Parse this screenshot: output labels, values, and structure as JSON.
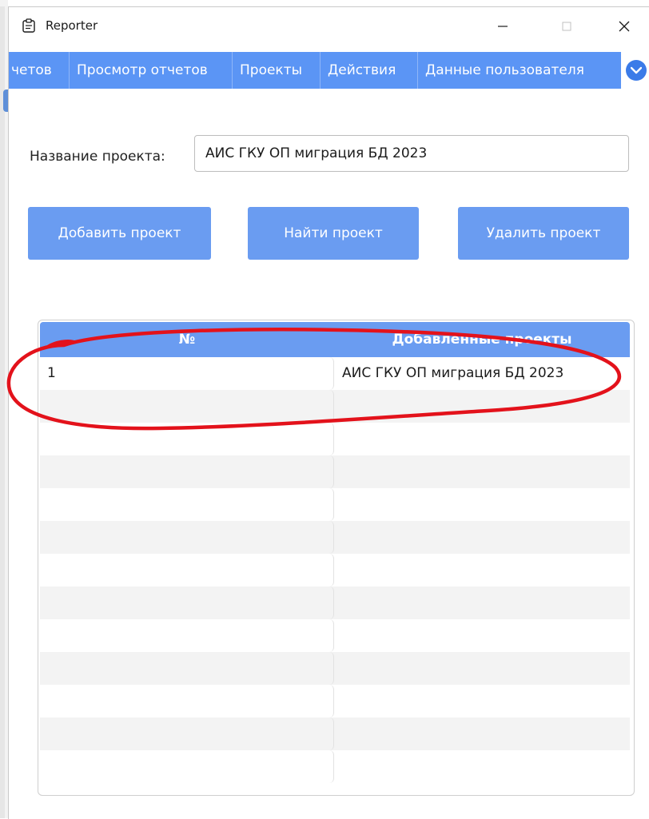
{
  "window": {
    "title": "Reporter",
    "controls": {
      "minimize": "—",
      "maximize": "□",
      "close": "✕"
    }
  },
  "tabs": [
    {
      "label": "четов"
    },
    {
      "label": "Просмотр отчетов"
    },
    {
      "label": "Проекты"
    },
    {
      "label": "Действия"
    },
    {
      "label": "Данные пользователя"
    }
  ],
  "form": {
    "project_name_label": "Название проекта:",
    "project_name_value": "АИС ГКУ ОП миграция БД 2023"
  },
  "buttons": {
    "add": "Добавить проект",
    "find": "Найти проект",
    "delete": "Удалить проект"
  },
  "table": {
    "headers": [
      "№",
      "Добавленные проекты"
    ],
    "rows": [
      [
        "1",
        "АИС ГКУ ОП миграция БД 2023"
      ],
      [
        "",
        ""
      ],
      [
        "",
        ""
      ],
      [
        "",
        ""
      ],
      [
        "",
        ""
      ],
      [
        "",
        ""
      ],
      [
        "",
        ""
      ],
      [
        "",
        ""
      ],
      [
        "",
        ""
      ],
      [
        "",
        ""
      ],
      [
        "",
        ""
      ],
      [
        "",
        ""
      ],
      [
        "",
        ""
      ]
    ]
  },
  "colors": {
    "accent": "#5b95f5",
    "button": "#6a9cf1",
    "annotation": "#e3121b"
  },
  "icons": {
    "app": "clipboard-icon",
    "tab_scroll": "chevron-down-icon"
  }
}
